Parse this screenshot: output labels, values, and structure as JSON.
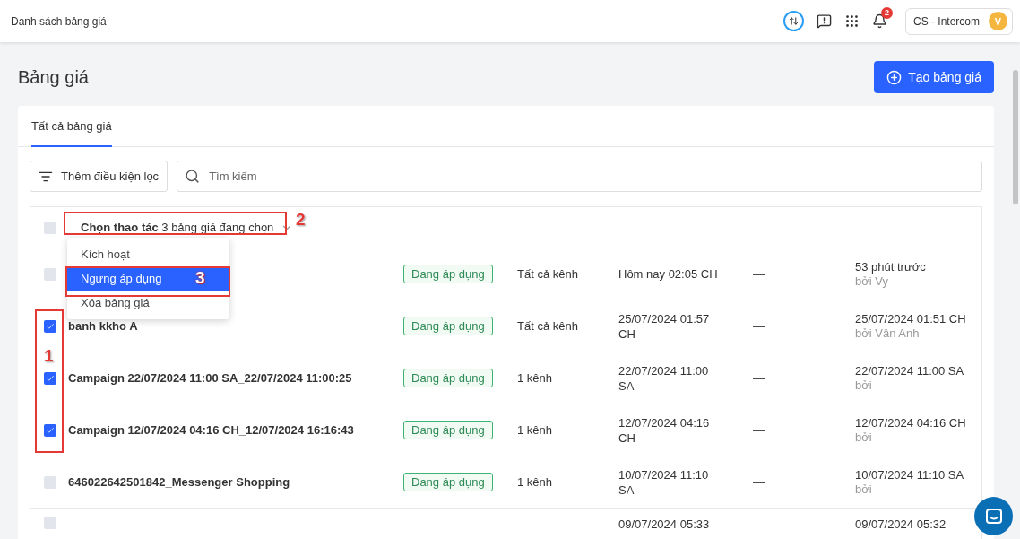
{
  "topbar": {
    "title": "Danh sách bảng giá",
    "notifications": "2",
    "account": "CS - Intercom",
    "avatar": "V"
  },
  "page": {
    "title": "Bảng giá",
    "create_button": "Tạo bảng giá"
  },
  "tabs": [
    {
      "label": "Tất cả bảng giá",
      "selected": true
    }
  ],
  "filter_button": "Thêm điều kiện lọc",
  "search": {
    "placeholder": "Tìm kiếm"
  },
  "bulk_action": {
    "checked": false,
    "label": "**Chọn thao tác** 3 bảng giá đang chọn"
  },
  "action_menu": [
    {
      "label": "Kích hoạt",
      "selected": false
    },
    {
      "label": "Ngưng áp dụng",
      "selected": true
    },
    {
      "label": "Xóa bảng giá",
      "selected": false
    }
  ],
  "rows": [
    {
      "checked": false,
      "status": "Đang áp dụng",
      "channels": "Tất cả kênh",
      "date": "Hôm nay 02:05 CH",
      "end": "—",
      "updated": "53 phút trước",
      "by": "bởi Vy"
    },
    {
      "checked": true,
      "name": "banh kkho A",
      "status": "Đang áp dụng",
      "channels": "Tất cả kênh",
      "date": "25/07/2024 01:57 CH",
      "end": "—",
      "updated": "25/07/2024 01:51 CH",
      "by": "bởi Vân Anh"
    },
    {
      "checked": true,
      "name": "Campaign 22/07/2024 11:00 SA_22/07/2024 11:00:25",
      "status": "Đang áp dụng",
      "channels": "1 kênh",
      "date": "22/07/2024 11:00 SA",
      "end": "—",
      "updated": "22/07/2024 11:00 SA",
      "by": "bởi"
    },
    {
      "checked": true,
      "name": "Campaign 12/07/2024 04:16 CH_12/07/2024 16:16:43",
      "status": "Đang áp dụng",
      "channels": "1 kênh",
      "date": "12/07/2024 04:16 CH",
      "end": "—",
      "updated": "12/07/2024 04:16 CH",
      "by": "bởi"
    },
    {
      "checked": false,
      "name": "646022642501842_Messenger Shopping",
      "status": "Đang áp dụng",
      "channels": "1 kênh",
      "date": "10/07/2024 11:10 SA",
      "end": "—",
      "updated": "10/07/2024 11:10 SA",
      "by": "bởi"
    },
    {
      "checked": false,
      "date": "09/07/2024 05:33",
      "updated": "09/07/2024 05:32"
    }
  ],
  "annotations": [
    {
      "label": "1"
    },
    {
      "label": "2"
    },
    {
      "label": "3"
    }
  ]
}
